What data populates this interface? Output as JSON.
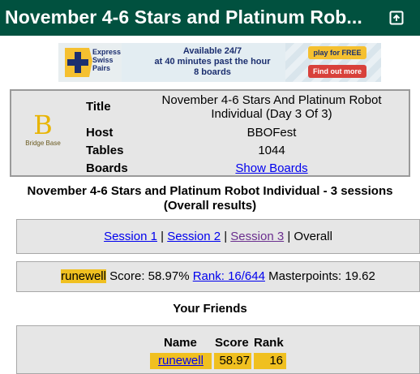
{
  "header": {
    "title": "November 4-6 Stars and Platinum Rob...",
    "open_icon": "open-in-new-icon",
    "bg_color": "#01513f"
  },
  "banner": {
    "logo_text": [
      "Express",
      "Swiss",
      "Pairs"
    ],
    "line1": "Available 24/7",
    "line2": "at 40 minutes past the hour",
    "line3": "8 boards",
    "play_label": "play for FREE",
    "find_label": "Find out more"
  },
  "info": {
    "logo_text": "Bridge Base",
    "title_label": "Title",
    "title_value": "November 4-6 Stars And Platinum Robot Individual (Day 3 Of 3)",
    "host_label": "Host",
    "host_value": "BBOFest",
    "tables_label": "Tables",
    "tables_value": "1044",
    "boards_label": "Boards",
    "boards_link": "Show Boards"
  },
  "heading": {
    "line1": "November 4-6 Stars and Platinum Robot Individual - 3 sessions",
    "line2": "(Overall results)"
  },
  "sessions": {
    "s1": "Session 1",
    "sep1": " | ",
    "s2": "Session 2",
    "sep2": " | ",
    "s3": "Session 3",
    "sep3": " | ",
    "overall": "Overall"
  },
  "score": {
    "user": "runewell",
    "score_text": " Score: 58.97% ",
    "rank_link": "Rank: 16/644",
    "masterpoints": "  Masterpoints: 19.62"
  },
  "friends": {
    "title": "Your Friends",
    "headers": {
      "name": "Name",
      "score": "Score",
      "rank": "Rank"
    },
    "rows": [
      {
        "name": "runewell",
        "score": "58.97",
        "rank": "16"
      }
    ]
  },
  "colors": {
    "highlight": "#f0c020",
    "panel": "#e6e6e6"
  }
}
